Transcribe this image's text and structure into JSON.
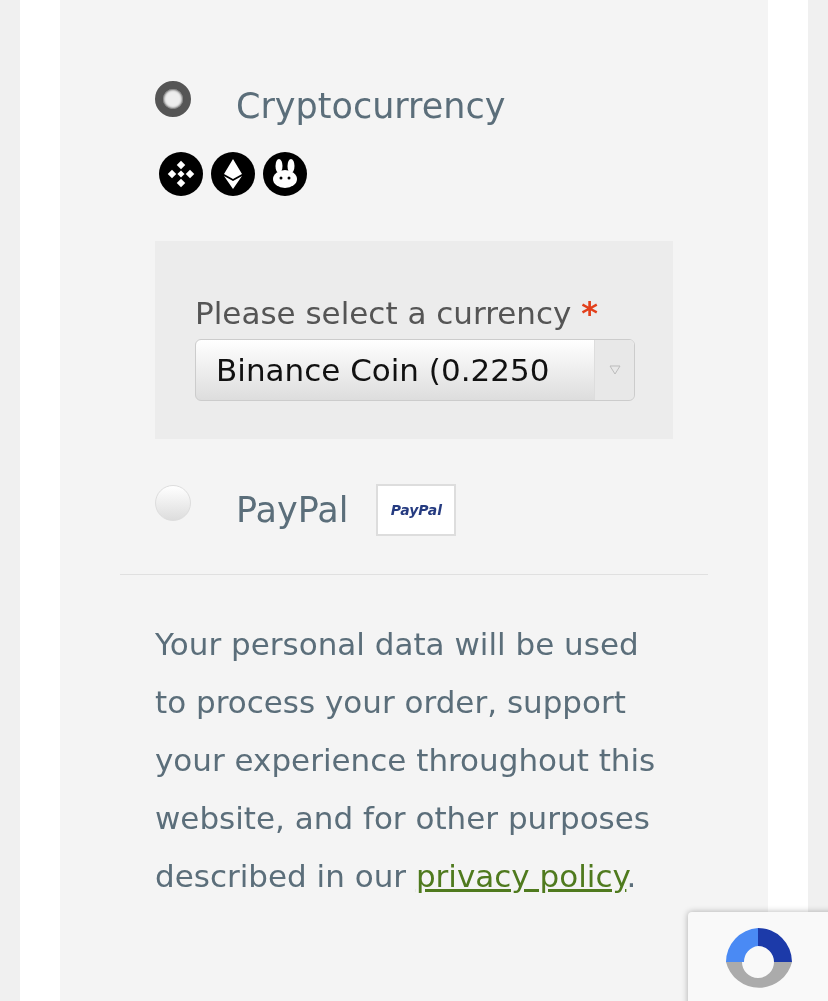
{
  "payment_methods": [
    {
      "kind": "crypto",
      "label": "Cryptocurrency",
      "selected": true,
      "field_label": "Please select a currency",
      "required_mark": "*",
      "currency_value": "Binance Coin (0.2250"
    },
    {
      "kind": "paypal",
      "label": "PayPal",
      "selected": false,
      "logo_text": "PayPal"
    }
  ],
  "privacy_notice": {
    "text": "Your personal data will be used to process your order, support your experience throughout this website, and for other purposes described in our ",
    "link": "privacy policy",
    "end": "."
  }
}
